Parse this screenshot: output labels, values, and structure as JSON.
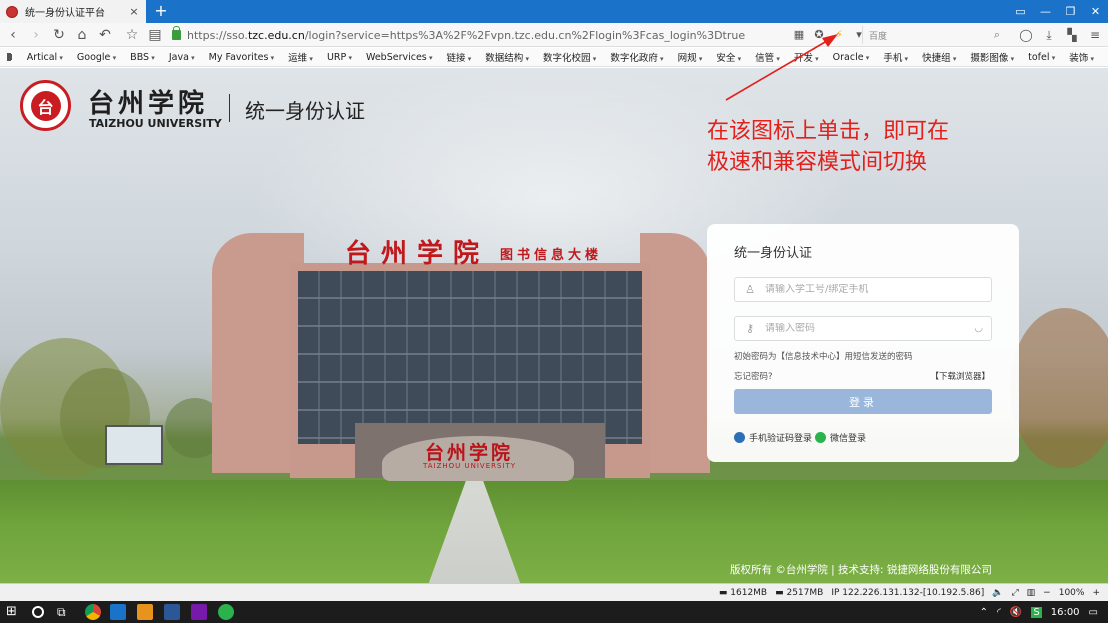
{
  "browser": {
    "tab_title": "统一身份认证平台",
    "tab_close": "×",
    "new_tab": "+",
    "url_prefix": "https://sso.",
    "url_host": "tzc.edu.cn",
    "url_rest": "/login?service=https%3A%2F%2Fvpn.tzc.edu.cn%2Flogin%3Fcas_login%3Dtrue",
    "search_placeholder": "百度",
    "bookmarks": [
      "Artical",
      "Google",
      "BBS",
      "Java",
      "My Favorites",
      "运维",
      "URP",
      "WebServices",
      "链接",
      "数据结构",
      "数字化校园",
      "数字化政府",
      "网规",
      "安全",
      "信管",
      "开发",
      "Oracle",
      "手机",
      "快捷组",
      "摄影图像",
      "tofel",
      "装饰"
    ]
  },
  "header": {
    "university_cn": "台州学院",
    "university_en": "TAIZHOU UNIVERSITY",
    "system_title": "统一身份认证",
    "seal_glyph": "台"
  },
  "scene": {
    "library_sign": "台州学院",
    "library_sign_sub": "图书信息大楼",
    "stone_title": "台州学院",
    "stone_sub": "TAIZHOU UNIVERSITY"
  },
  "annotation": {
    "text": "在该图标上单击，即可在\n极速和兼容模式间切换",
    "color": "#e3201c"
  },
  "login": {
    "title": "统一身份认证",
    "username_placeholder": "请输入学工号/绑定手机",
    "password_placeholder": "请输入密码",
    "hint": "初始密码为【信息技术中心】用短信发送的密码",
    "forgot": "忘记密码?",
    "download": "【下载浏览器】",
    "button": "登录",
    "alt_phone": "手机验证码登录",
    "alt_wechat": "微信登录",
    "button_color": "#9ab7db"
  },
  "footer": {
    "copyright": "版权所有  ©台州学院 | 技术支持: 锐捷网络股份有限公司"
  },
  "status": {
    "mem1": "1612MB",
    "mem2": "2517MB",
    "ip": "IP 122.226.131.132-[10.192.5.86]",
    "zoom": "100%"
  },
  "taskbar": {
    "time": "16:00"
  }
}
